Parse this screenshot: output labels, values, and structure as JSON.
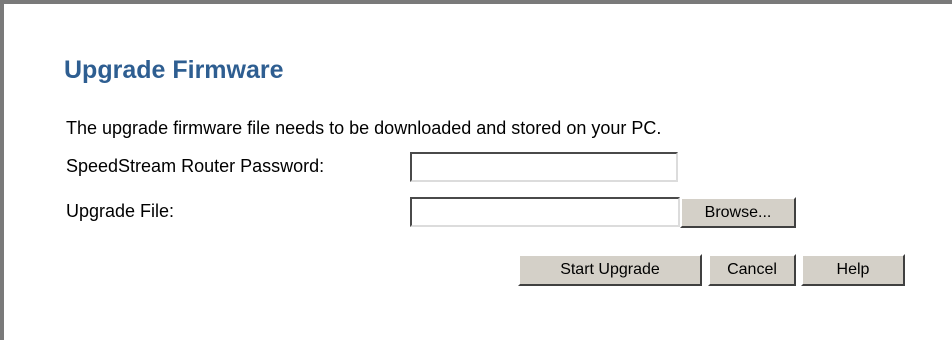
{
  "page": {
    "title": "Upgrade Firmware",
    "intro": "The upgrade firmware file needs to be downloaded and stored on your PC.",
    "title_color": "#2e5e91"
  },
  "form": {
    "password_label": "SpeedStream Router Password:",
    "password_value": "",
    "file_label": "Upgrade File:",
    "file_value": "",
    "browse_label": "Browse..."
  },
  "actions": {
    "start_label": "Start Upgrade",
    "cancel_label": "Cancel",
    "help_label": "Help"
  }
}
